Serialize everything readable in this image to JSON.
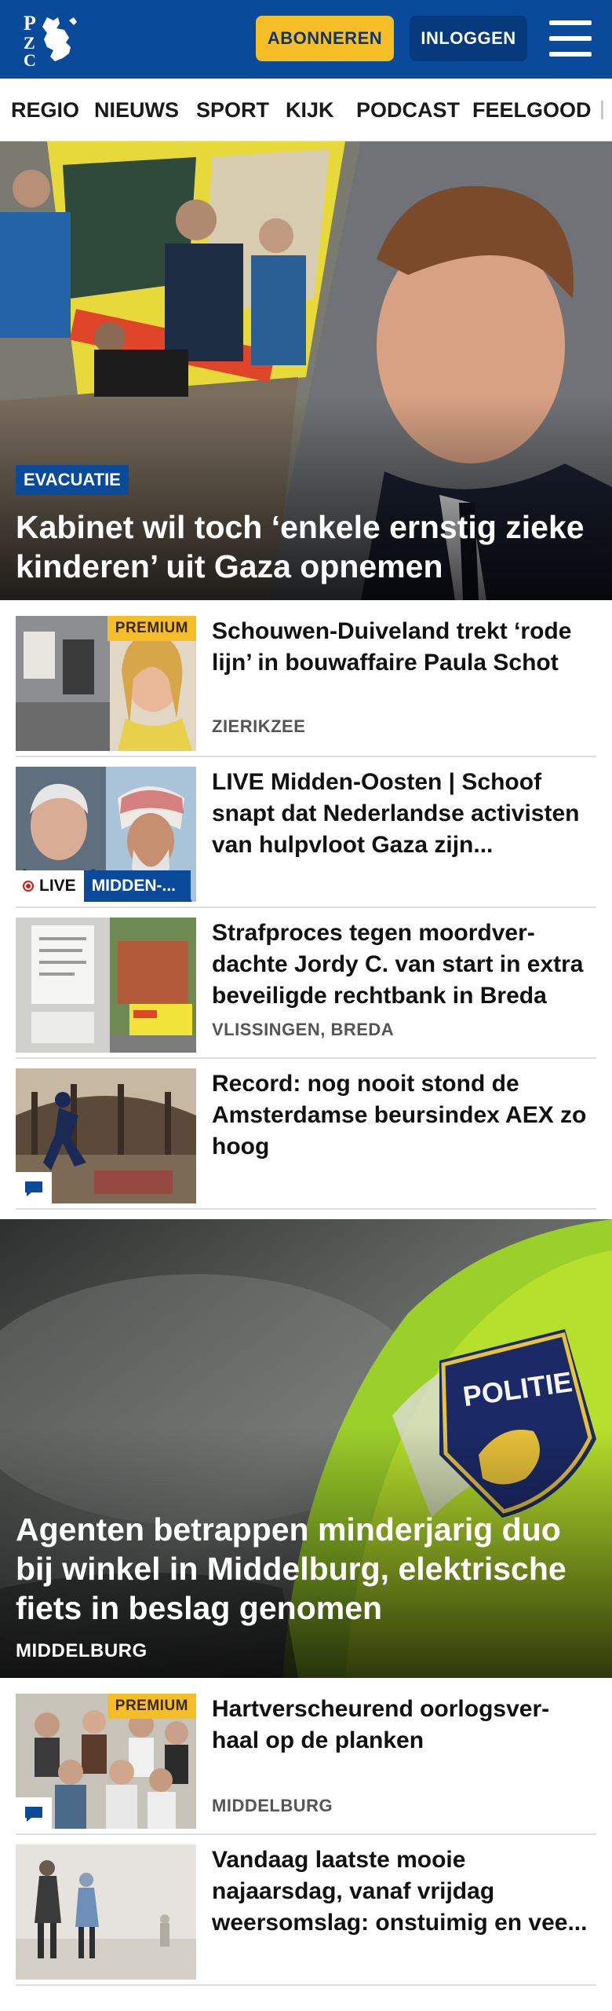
{
  "header": {
    "logo_text": "PZC",
    "subscribe_label": "ABONNEREN",
    "login_label": "INLOGGEN",
    "menu_icon": "hamburger-menu-icon"
  },
  "nav": {
    "items": [
      "REGIO",
      "NIEUWS",
      "SPORT",
      "KIJK",
      "PODCAST",
      "FEELGOOD"
    ]
  },
  "hero": {
    "tag": "EVACUATIE",
    "title": "Kabinet wil toch ‘enkele ernstig zieke kinderen’ uit Gaza opnemen"
  },
  "articles": [
    {
      "title": "Schouwen-Duiveland trekt ‘rode lijn’ in bouwaffaire Paula Schot",
      "location": "ZIERIKZEE",
      "badge": "PREMIUM"
    },
    {
      "title": "LIVE Midden-Oosten | Schoof snapt dat Nederlandse activisten van hulpvloot Gaza zijn...",
      "live_label": "LIVE",
      "live_tag": "MIDDEN-..."
    },
    {
      "title": "Strafproces tegen moordver-dachte Jordy C. van start in extra beveiligde rechtbank in Breda",
      "location": "VLISSINGEN, BREDA"
    },
    {
      "title": "Record: nog nooit stond de Amsterdamse beursindex AEX zo hoog",
      "comment_icon": "comment-icon"
    }
  ],
  "hero2": {
    "title": "Agenten betrappen minderjarig duo bij winkel in Middelburg, elektrische fiets in beslag genomen",
    "location": "MIDDELBURG",
    "patch_text": "POLITIE"
  },
  "articles2": [
    {
      "title": "Hartverscheurend oorlogsver-haal op de planken",
      "location": "MIDDELBURG",
      "badge": "PREMIUM",
      "comment_icon": "comment-icon"
    },
    {
      "title": "Vandaag laatste mooie najaarsdag, vanaf vrijdag weersomslag: onstuimig en vee..."
    }
  ],
  "colors": {
    "brand_blue": "#0a4a9b",
    "accent_yellow": "#f5be26",
    "live_red": "#d31a1a"
  }
}
